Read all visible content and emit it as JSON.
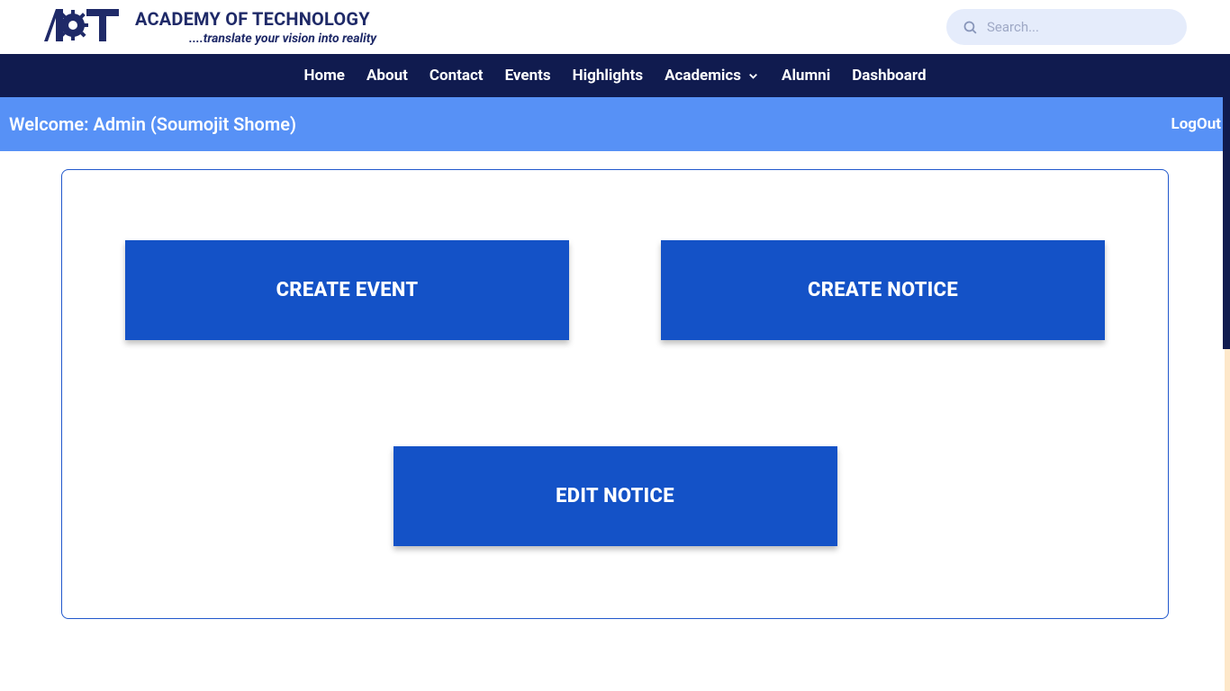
{
  "header": {
    "title": "ACADEMY OF TECHNOLOGY",
    "tagline": "....translate your vision into reality"
  },
  "search": {
    "placeholder": "Search..."
  },
  "nav": {
    "home": "Home",
    "about": "About",
    "contact": "Contact",
    "events": "Events",
    "highlights": "Highlights",
    "academics": "Academics",
    "alumni": "Alumni",
    "dashboard": "Dashboard"
  },
  "welcome": {
    "text": "Welcome: Admin (Soumojit Shome)",
    "logout": "LogOut"
  },
  "actions": {
    "create_event": "CREATE EVENT",
    "create_notice": "CREATE NOTICE",
    "edit_notice": "EDIT NOTICE"
  }
}
